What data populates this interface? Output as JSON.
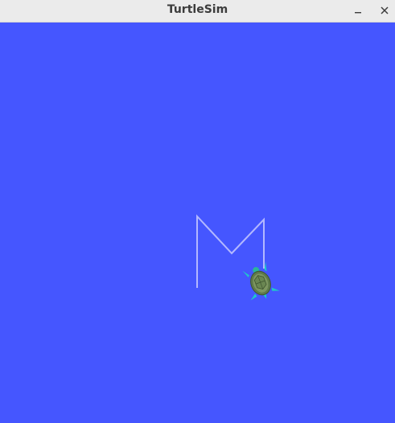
{
  "window": {
    "title": "TurtleSim"
  },
  "titlebar": {
    "minimize_icon": "minimize-icon",
    "close_icon": "close-icon"
  },
  "canvas": {
    "background_color": "#4556ff",
    "pen_color": "#b3b8ff"
  }
}
